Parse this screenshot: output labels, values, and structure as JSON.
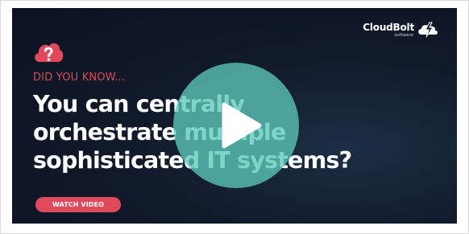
{
  "banner": {
    "logo": {
      "word": "CloudBolt",
      "sub": "software"
    },
    "kicker": "DID YOU KNOW...",
    "headline": [
      "You can centrally",
      "orchestrate multiple",
      "sophisticated IT systems?"
    ],
    "button_label": "WATCH VIDEO",
    "icons": {
      "question": "question-cloud-icon",
      "play": "play-icon",
      "logo": "cloudbolt-logo-icon"
    },
    "colors": {
      "accent": "#e0485c",
      "play": "#5cc8ba",
      "background": "#111a2a",
      "text": "#ffffff"
    }
  }
}
